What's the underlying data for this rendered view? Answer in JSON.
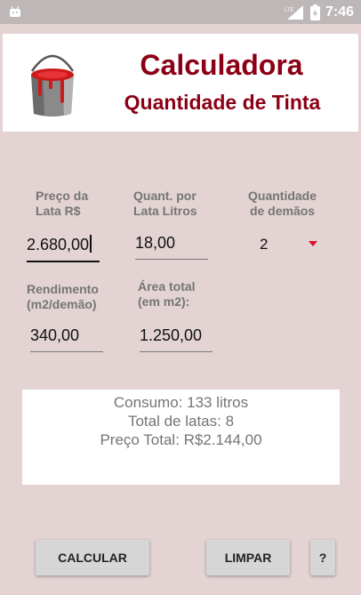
{
  "status_bar": {
    "time": "7:46",
    "network": "LTE"
  },
  "header": {
    "title": "Calculadora",
    "subtitle": "Quantidade de Tinta"
  },
  "form": {
    "preco_label_1": "Preço da",
    "preco_label_2": "Lata R$",
    "preco_value": "2.680,00",
    "quant_label_1": "Quant. por",
    "quant_label_2": "Lata Litros",
    "quant_value": "18,00",
    "demaos_label_1": "Quantidade",
    "demaos_label_2": "de demãos",
    "demaos_value": "2",
    "rendimento_label_1": "Rendimento",
    "rendimento_label_2": "(m2/demão)",
    "rendimento_value": "340,00",
    "area_label_1": "Área total",
    "area_label_2": "(em m2):",
    "area_value": "1.250,00"
  },
  "result": {
    "consumo": "Consumo: 133 litros",
    "total_latas": "Total de latas: 8",
    "preco_total": "Preço Total: R$2.144,00"
  },
  "buttons": {
    "calcular": "CALCULAR",
    "limpar": "LIMPAR",
    "help": "?"
  }
}
